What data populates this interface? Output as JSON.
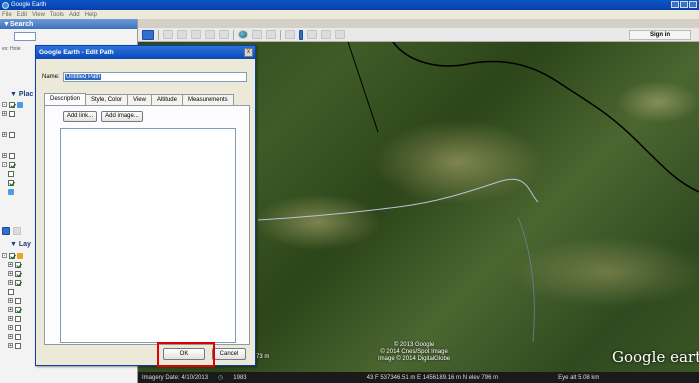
{
  "window": {
    "title": "Google Earth"
  },
  "menu": [
    "File",
    "Edit",
    "View",
    "Tools",
    "Add",
    "Help"
  ],
  "left_panel": {
    "search_header": "▼Search",
    "hint_text": "ex: Hote",
    "places_header": "▼ Plac",
    "layers_header": "▼ Lay"
  },
  "toolbar": {
    "signin_label": "Sign in"
  },
  "dialog": {
    "title": "Google Earth - Edit Path",
    "close_label": "x",
    "name_label": "Name:",
    "name_value": "Untitled Path",
    "tabs": [
      {
        "label": "Description"
      },
      {
        "label": "Style, Color"
      },
      {
        "label": "View"
      },
      {
        "label": "Altitude"
      },
      {
        "label": "Measurements"
      }
    ],
    "add_link_label": "Add link...",
    "add_image_label": "Add image...",
    "ok_label": "OK",
    "cancel_label": "Cancel"
  },
  "map": {
    "attribution_lines": [
      "© 2013 Google",
      "© 2014 Cnes/Spot Image",
      "Image © 2014 DigitalGlobe"
    ],
    "logo": "Google earth",
    "scale_fragment": "73 m"
  },
  "statusbar": {
    "imagery_date": "Imagery Date: 4/10/2013",
    "year": "1983",
    "coords": "43 F 537346.51 m E 1456189.16 m N elev  796 m",
    "eye_alt": "Eye alt   5.08 km"
  },
  "colors": {
    "highlight": "#e00000",
    "title_blue": "#0b48b7"
  }
}
